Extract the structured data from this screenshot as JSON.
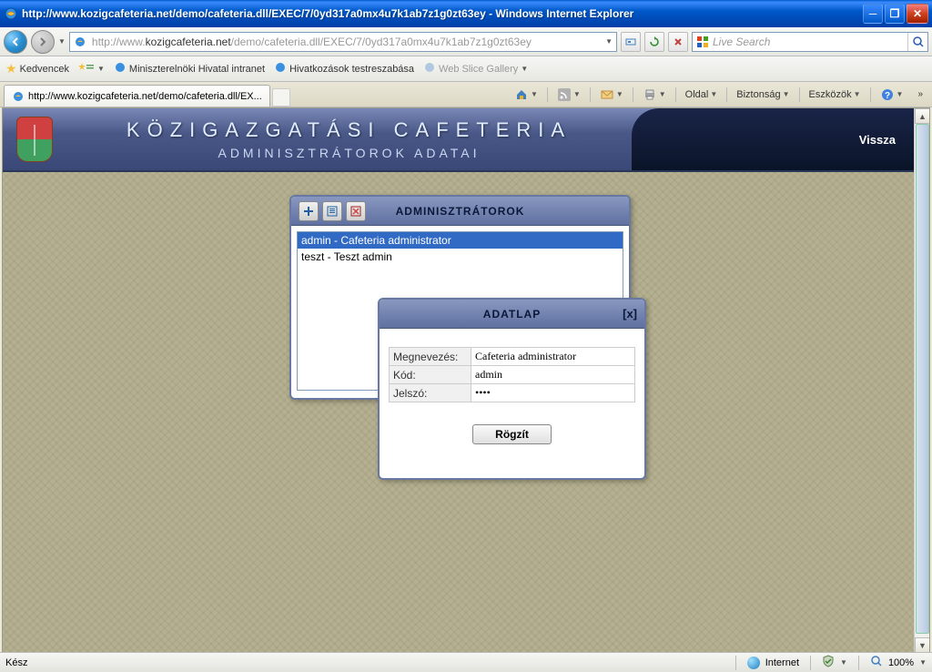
{
  "window": {
    "title": "http://www.kozigcafeteria.net/demo/cafeteria.dll/EXEC/7/0yd317a0mx4u7k1ab7z1g0zt63ey - Windows Internet Explorer"
  },
  "address": {
    "url_pre": "http://www.",
    "url_bold": "kozigcafeteria.net",
    "url_post": "/demo/cafeteria.dll/EXEC/7/0yd317a0mx4u7k1ab7z1g0zt63ey"
  },
  "search": {
    "placeholder": "Live Search"
  },
  "favorites": {
    "label": "Kedvencek",
    "items": [
      "Miniszterelnöki Hivatal intranet",
      "Hivatkozások testreszabása",
      "Web Slice Gallery"
    ]
  },
  "tab": {
    "title": "http://www.kozigcafeteria.net/demo/cafeteria.dll/EX..."
  },
  "commandbar": {
    "page": "Oldal",
    "security": "Biztonság",
    "tools": "Eszközök"
  },
  "app": {
    "title": "KÖZIGAZGATÁSI CAFETERIA",
    "subtitle": "ADMINISZTRÁTOROK ADATAI",
    "back": "Vissza"
  },
  "admin_panel": {
    "title": "ADMINISZTRÁTOROK",
    "items": [
      {
        "text": "admin - Cafeteria administrator",
        "selected": true
      },
      {
        "text": "teszt - Teszt admin",
        "selected": false
      }
    ]
  },
  "form_panel": {
    "title": "ADATLAP",
    "close": "[x]",
    "fields": {
      "name_label": "Megnevezés:",
      "name_value": "Cafeteria administrator",
      "code_label": "Kód:",
      "code_value": "admin",
      "pass_label": "Jelszó:",
      "pass_value": "••••"
    },
    "submit": "Rögzít"
  },
  "status": {
    "ready": "Kész",
    "zone": "Internet",
    "zoom": "100%"
  }
}
